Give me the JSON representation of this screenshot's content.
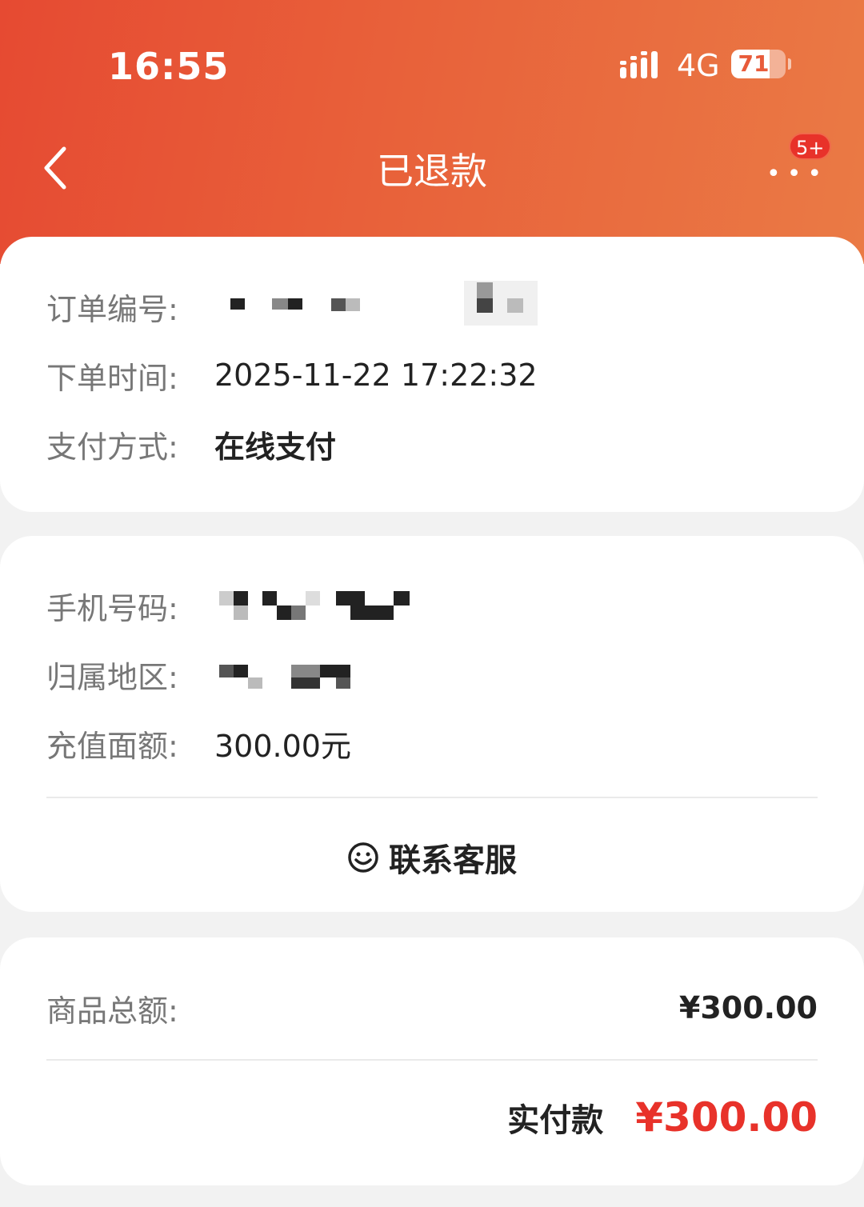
{
  "status_bar": {
    "time": "16:55",
    "network": "4G",
    "battery": "71",
    "battery_level": 0.71
  },
  "nav": {
    "title": "已退款",
    "back_icon": "chevron-left-icon",
    "more_icon": "more-dots-icon",
    "badge": "5+"
  },
  "order_info": {
    "order_no_label": "订单编号:",
    "order_time_label": "下单时间:",
    "order_time": "2025-11-22 17:22:32",
    "pay_method_label": "支付方式:",
    "pay_method": "在线支付"
  },
  "recharge_info": {
    "phone_label": "手机号码:",
    "region_label": "归属地区:",
    "amount_label": "充值面额:",
    "amount": "300.00元",
    "contact_label": "联系客服",
    "contact_icon": "smile-chat-icon"
  },
  "summary": {
    "goods_total_label": "商品总额:",
    "goods_total": "¥300.00",
    "actual_paid_label": "实付款",
    "actual_paid": "¥300.00"
  },
  "colors": {
    "header_start": "#e64a32",
    "header_end": "#ea7a45",
    "accent_red": "#e8322a",
    "label_gray": "#777777",
    "text_dark": "#222222",
    "background": "#f2f2f2"
  }
}
